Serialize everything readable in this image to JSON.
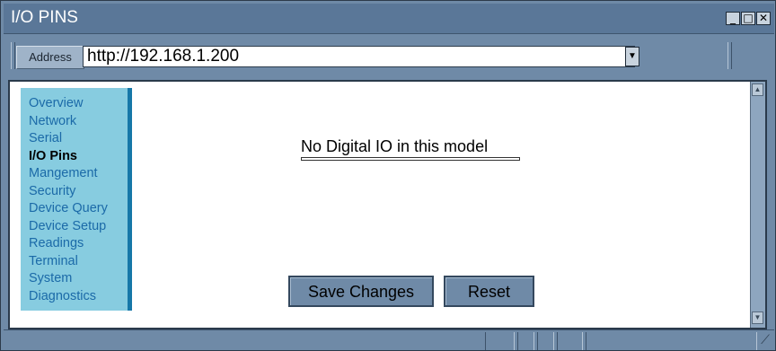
{
  "window": {
    "title": "I/O PINS",
    "minimize_glyph": "_",
    "maximize_glyph": "□",
    "close_glyph": "✕"
  },
  "address_bar": {
    "label": "Address",
    "url": "http://192.168.1.200",
    "dropdown_glyph": "▼"
  },
  "sidebar": {
    "items": [
      {
        "label": "Overview",
        "active": false
      },
      {
        "label": "Network",
        "active": false
      },
      {
        "label": "Serial",
        "active": false
      },
      {
        "label": "I/O Pins",
        "active": true
      },
      {
        "label": "Mangement",
        "active": false
      },
      {
        "label": "Security",
        "active": false
      },
      {
        "label": "Device Query",
        "active": false
      },
      {
        "label": "Device Setup",
        "active": false
      },
      {
        "label": "Readings",
        "active": false
      },
      {
        "label": "Terminal",
        "active": false
      },
      {
        "label": "System",
        "active": false
      },
      {
        "label": "Diagnostics",
        "active": false
      }
    ]
  },
  "main": {
    "message": "No Digital IO in this model",
    "save_label": "Save Changes",
    "reset_label": "Reset"
  },
  "scrollbar": {
    "up_glyph": "▲",
    "down_glyph": "▼"
  },
  "statusbar": {
    "grip_glyph": "⟋"
  },
  "colors": {
    "chrome": "#6f8aa7",
    "sidebar_bg": "#87cce0",
    "sidebar_accent": "#1677a8",
    "nav_link": "#1b6aa8"
  }
}
